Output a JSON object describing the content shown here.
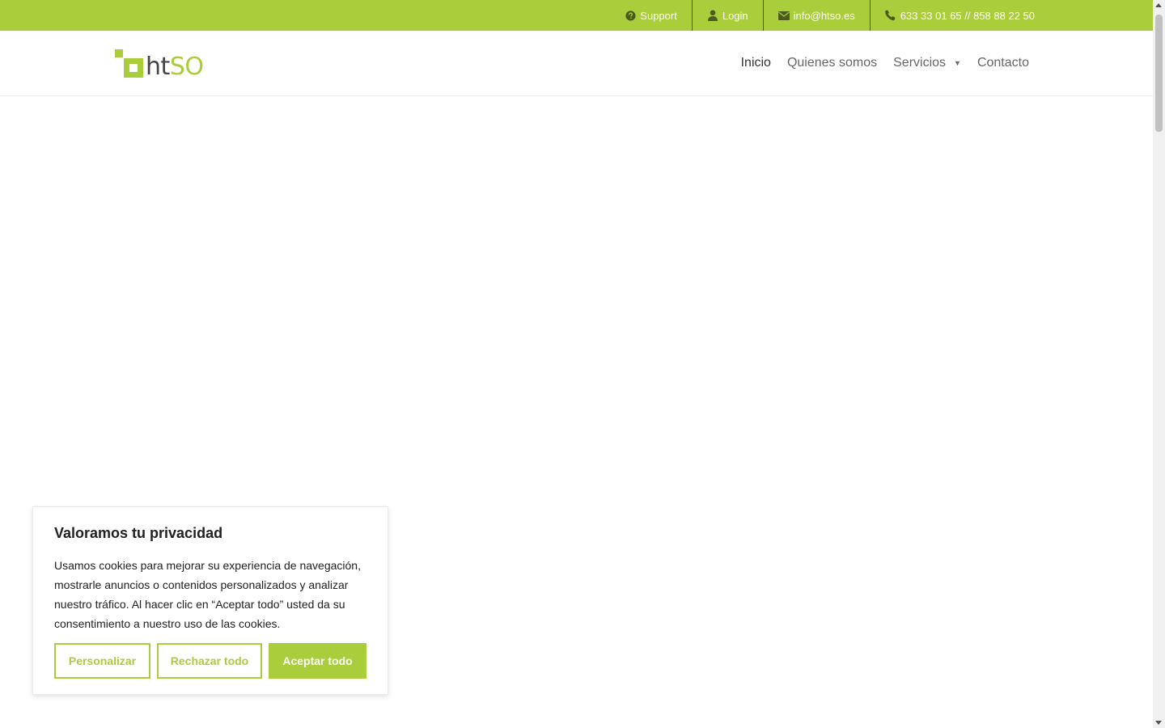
{
  "topbar": {
    "background": "#a9cd3b",
    "items": [
      {
        "icon": "question-circle-icon",
        "label": "Support"
      },
      {
        "icon": "user-icon",
        "label": "Login"
      },
      {
        "icon": "envelope-icon",
        "label": "info@htso.es"
      },
      {
        "icon": "phone-icon",
        "label": "633 33 01 65 // 858 88 22 50"
      }
    ]
  },
  "header": {
    "logo": {
      "part1": "ht",
      "part2": "SO"
    },
    "nav": [
      {
        "label": "Inicio",
        "active": true
      },
      {
        "label": "Quienes somos"
      },
      {
        "label": "Servicios",
        "has_dropdown": true,
        "caret": "▼"
      },
      {
        "label": "Contacto"
      }
    ]
  },
  "cookie_banner": {
    "title": "Valoramos tu privacidad",
    "text": "Usamos cookies para mejorar su experiencia de navegación, mostrarle anuncios o contenidos personalizados y analizar nuestro tráfico. Al hacer clic en “Aceptar todo” usted da su consentimiento a nuestro uso de las cookies.",
    "buttons": {
      "customize": "Personalizar",
      "reject": "Rechazar todo",
      "accept": "Aceptar todo"
    },
    "accent": "#a9cd3b"
  }
}
